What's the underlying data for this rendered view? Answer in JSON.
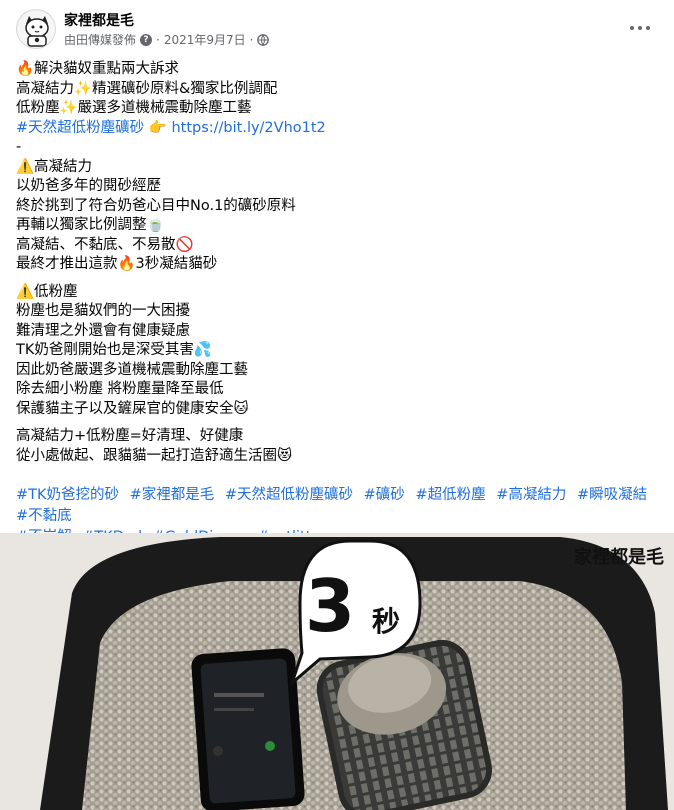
{
  "post": {
    "page_name": "家裡都是毛",
    "meta_by": "由田傳媒發佈",
    "meta_date": "2021年9月7日",
    "meta_sep": "·",
    "more_options_icon": "more-dots-icon",
    "body": {
      "p1_l1": "🔥解決貓奴重點兩大訴求",
      "p1_l2": "高凝結力✨精選礦砂原料&獨家比例調配",
      "p1_l3": "低粉塵✨嚴選多道機械震動除塵工藝",
      "p1_tag": "#天然超低粉塵礦砂",
      "p1_point": "👉",
      "p1_url": "https://bit.ly/2Vho1t2",
      "p1_dash": "-",
      "p2_head": "⚠️高凝結力",
      "p2_l1": "以奶爸多年的閱砂經歷",
      "p2_l2": "終於挑到了符合奶爸心目中No.1的礦砂原料",
      "p2_l3": "再輔以獨家比例調整🍵",
      "p2_l4": "高凝結、不黏底、不易散🚫",
      "p2_l5": "最終才推出這款🔥3秒凝結貓砂",
      "p3_head": "⚠️低粉塵",
      "p3_l1": "粉塵也是貓奴們的一大困擾",
      "p3_l2": "難清理之外還會有健康疑慮",
      "p3_l3": "TK奶爸剛開始也是深受其害💦",
      "p3_l4": "因此奶爸嚴選多道機械震動除塵工藝",
      "p3_l5": "除去細小粉塵 將粉塵量降至最低",
      "p3_l6": "保護貓主子以及鏟屎官的健康安全🐱",
      "p4_l1": "高凝結力+低粉塵=好清理、好健康",
      "p4_l2": "從小處做起、跟貓貓一起打造舒適生活圈😻"
    },
    "hashtags": [
      "#TK奶爸挖的砂",
      "#家裡都是毛",
      "#天然超低粉塵礦砂",
      "#礦砂",
      "#超低粉塵",
      "#高凝結力",
      "#瞬吸凝結",
      "#不黏底",
      "#不崩解",
      "#TKDad",
      "#GoldDigger",
      "#catlitter"
    ],
    "media": {
      "bubble_number": "3",
      "bubble_unit": "秒",
      "watermark": "家裡都是毛"
    }
  },
  "colors": {
    "link": "#216fdb",
    "meta": "#65676b",
    "text": "#050505"
  }
}
